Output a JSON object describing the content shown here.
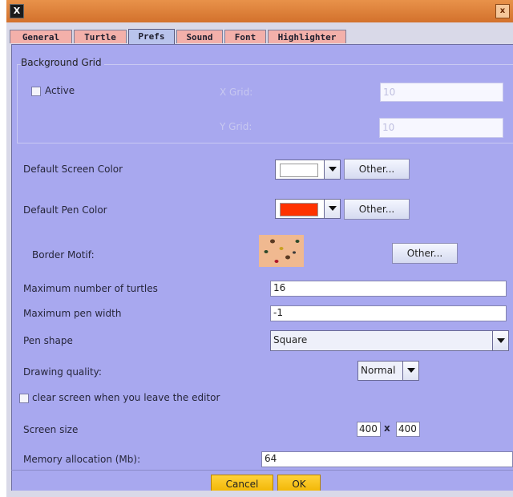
{
  "window": {
    "close_glyph": "x"
  },
  "tabs": [
    "General",
    "Turtle",
    "Prefs",
    "Sound",
    "Font",
    "Highlighter"
  ],
  "background_grid": {
    "title": "Background Grid",
    "active_label": "Active",
    "active_checked": false,
    "x_label": "X Grid:",
    "x_value": "10",
    "y_label": "Y Grid:",
    "y_value": "10"
  },
  "screen_color": {
    "label": "Default Screen Color",
    "color": "#ffffff",
    "other_label": "Other..."
  },
  "pen_color": {
    "label": "Default Pen Color",
    "color": "#ff3300",
    "other_label": "Other..."
  },
  "border_motif": {
    "label": "Border Motif:",
    "other_label": "Other..."
  },
  "max_turtles": {
    "label": "Maximum number of turtles",
    "value": "16"
  },
  "max_pen_width": {
    "label": "Maximum pen width",
    "value": "-1"
  },
  "pen_shape": {
    "label": "Pen shape",
    "value": "Square"
  },
  "drawing_quality": {
    "label": "Drawing quality:",
    "value": "Normal"
  },
  "clear_screen": {
    "label": "clear screen when you leave the editor",
    "checked": false
  },
  "screen_size": {
    "label": "Screen size",
    "width": "400",
    "sep": "x",
    "height": "400"
  },
  "memory": {
    "label": "Memory allocation (Mb):",
    "value": "64"
  },
  "footer": {
    "cancel_label": "Cancel",
    "ok_label": "OK"
  },
  "colors": {
    "panel": "#a8a8ef",
    "titlebar": "#e0843e",
    "tab": "#f3b0aa",
    "ok_button": "#ffc61a"
  }
}
